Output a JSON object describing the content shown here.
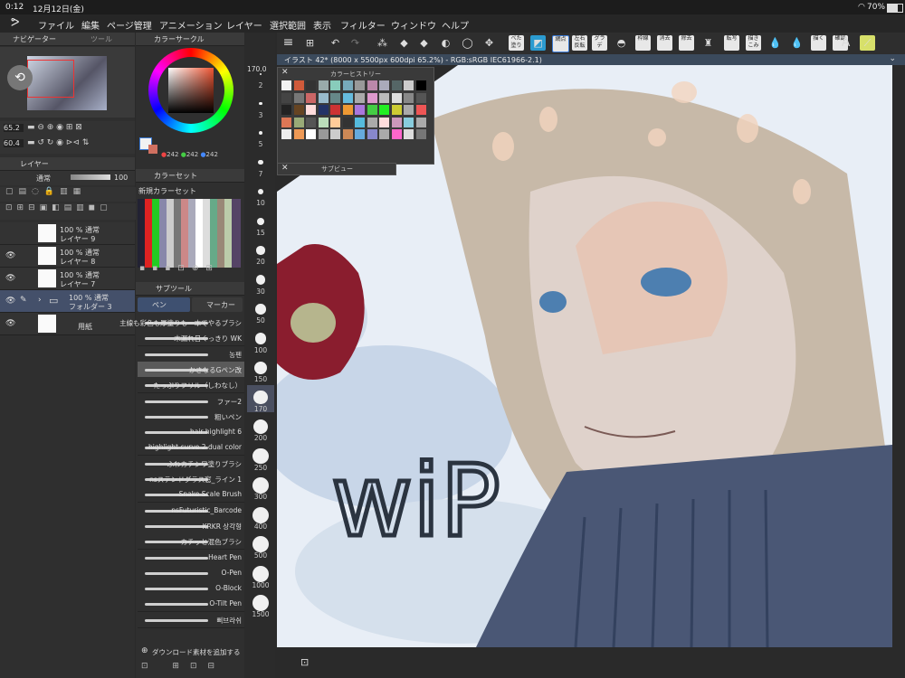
{
  "status_bar": {
    "time": "0:12",
    "date": "12月12日(金)",
    "battery": "70%"
  },
  "menu": [
    "ファイル",
    "編集",
    "ページ管理",
    "アニメーション",
    "レイヤー",
    "選択範囲",
    "表示",
    "フィルター",
    "ウィンドウ",
    "ヘルプ"
  ],
  "toolbar": {
    "labels": {
      "fill": "べた塗り",
      "tone": "網点",
      "flip": "左右反転",
      "gradient": "グラデ",
      "frame": "枠線",
      "erase": "消去",
      "remove": "除去",
      "lock": "転写",
      "draw1": "描きこみ",
      "draw2": "描く",
      "clear": "消去",
      "check": "確認"
    }
  },
  "navigator": {
    "tab": "ナビゲーター",
    "tool_tab": "ツール",
    "zoom": "65.2",
    "angle": "60.4"
  },
  "layer_panel": {
    "tab": "レイヤー",
    "blend_mode": "通常",
    "opacity": "100",
    "layers": [
      {
        "opacity": "100 % 通常",
        "name": "レイヤー 9",
        "selected": false,
        "visible": false
      },
      {
        "opacity": "100 % 通常",
        "name": "レイヤー 8",
        "selected": false,
        "visible": true
      },
      {
        "opacity": "100 % 通常",
        "name": "レイヤー 7",
        "selected": false,
        "visible": true
      },
      {
        "opacity": "100 % 通常",
        "name": "フォルダー 3",
        "selected": true,
        "visible": true
      },
      {
        "opacity": "",
        "name": "用紙",
        "selected": false,
        "visible": true
      }
    ]
  },
  "color_circle": {
    "tab": "カラーサークル",
    "r": "242",
    "g": "242",
    "b": "242"
  },
  "color_set": {
    "tab": "カラーセット",
    "name": "新規カラーセット"
  },
  "sub_tool": {
    "tab": "サブツール",
    "tabs": [
      "ペン",
      "マーカー"
    ],
    "brushes": [
      "主線も彩色も厚塗りも一本でやるブラシ",
      "木漏れ日くっきり WK",
      "농펜",
      "かさなるGペン改",
      "たっぷりフリル（しわなし）",
      "ファー2",
      "粗いペン",
      "hair highlight 6",
      "highlight curve 2 dual color",
      "ふわカチシワ塗りブラシ",
      "nsステンドグラス窓_ライン 1",
      "Snake Scale Brush",
      "nsFuturistic_Barcode",
      "KRKR 상각형",
      "カチッと混色ブラシ",
      "Heart Pen",
      "O-Pen",
      "O-Block",
      "O-Tilt Pen",
      "삐브라쉬"
    ],
    "selected_index": 3,
    "download": "ダウンロード素材を追加する"
  },
  "brush_size": {
    "current": "170.0",
    "sizes": [
      "2",
      "3",
      "5",
      "7",
      "10",
      "15",
      "20",
      "30",
      "50",
      "100",
      "150",
      "170",
      "200",
      "250",
      "300",
      "400",
      "500",
      "1000",
      "1500"
    ],
    "selected": "170"
  },
  "canvas": {
    "title": "イラスト 42* (8000 x 5500px 600dpi 65.2%) - RGB:sRGB IEC61966-2.1)",
    "wip_text": "wiP"
  },
  "color_history": {
    "title": "カラーヒストリー"
  },
  "subview": {
    "title": "サブビュー"
  },
  "colors": {
    "accent": "#3b7bd6",
    "panel": "#2f2f2f",
    "selection": "#44506a"
  }
}
